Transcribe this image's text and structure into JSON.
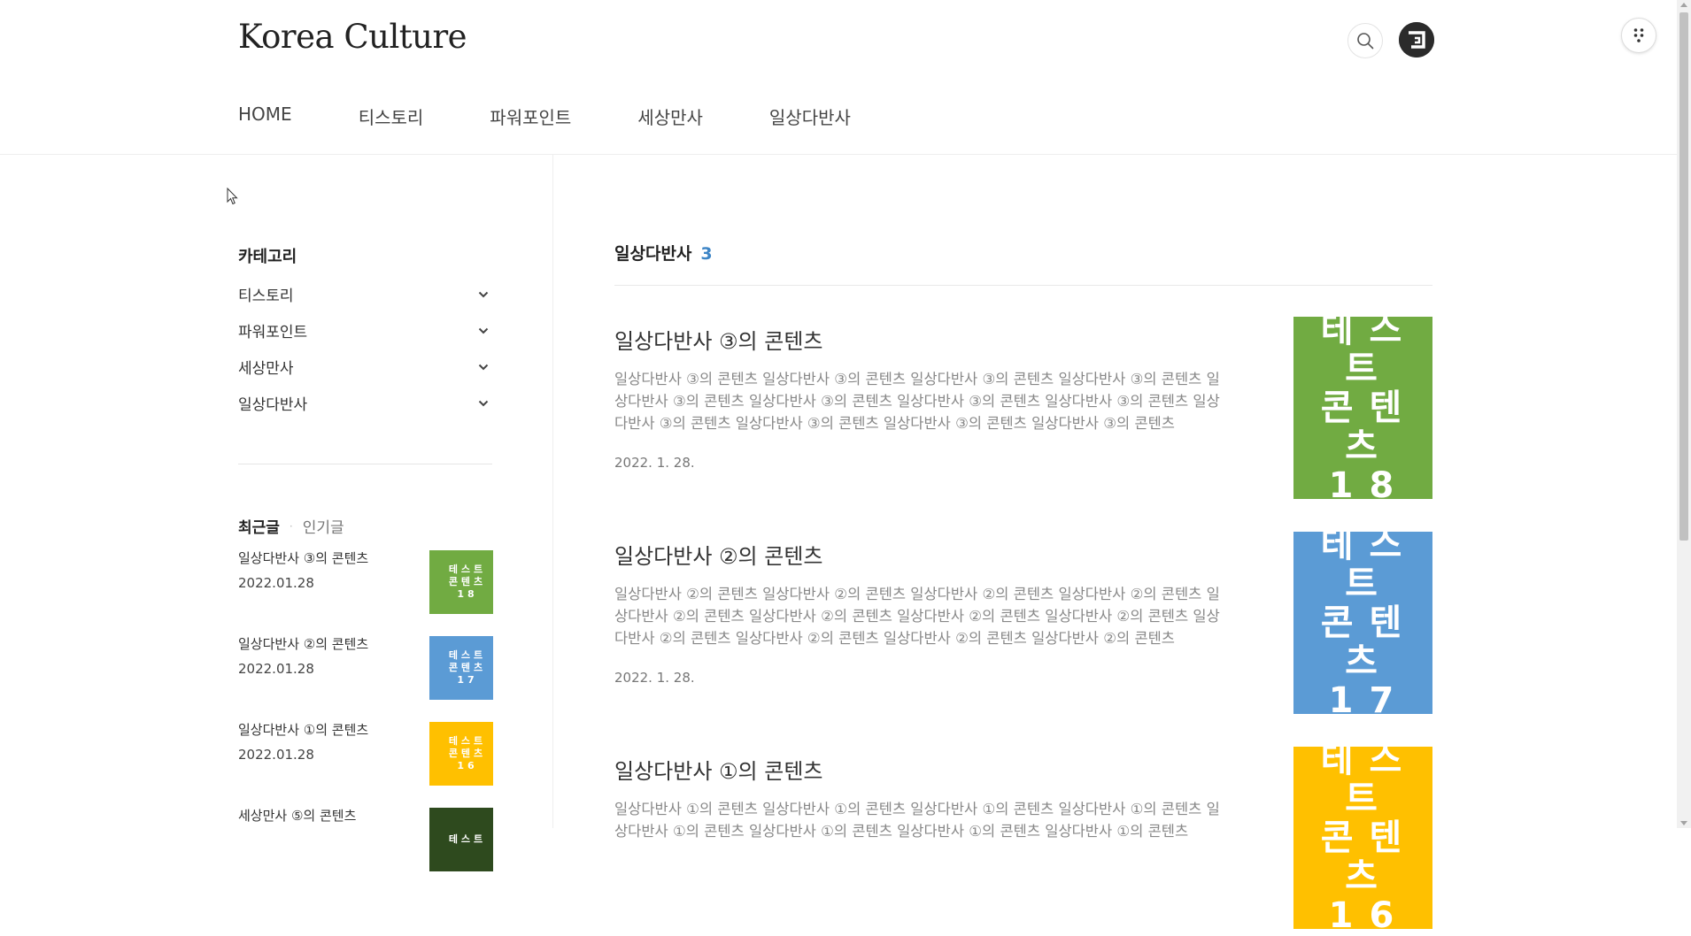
{
  "site": {
    "title": "Korea Culture"
  },
  "nav": {
    "items": [
      "HOME",
      "티스토리",
      "파워포인트",
      "세상만사",
      "일상다반사"
    ]
  },
  "sidebar": {
    "category_title": "카테고리",
    "categories": [
      "티스토리",
      "파워포인트",
      "세상만사",
      "일상다반사"
    ],
    "tabs": {
      "recent": "최근글",
      "popular": "인기글"
    },
    "recent_posts": [
      {
        "title": "일상다반사 ③의 콘텐츠",
        "date": "2022.01.28",
        "thumb_text": "테스트\n콘텐츠\n18",
        "thumb_color": "#71ab42"
      },
      {
        "title": "일상다반사 ②의 콘텐츠",
        "date": "2022.01.28",
        "thumb_text": "테스트\n콘텐츠\n17",
        "thumb_color": "#5b9bd5"
      },
      {
        "title": "일상다반사 ①의 콘텐츠",
        "date": "2022.01.28",
        "thumb_text": "테스트\n콘텐츠\n16",
        "thumb_color": "#ffc000"
      },
      {
        "title": "세상만사 ⑤의 콘텐츠",
        "date": "",
        "thumb_text": "테스트",
        "thumb_color": "#2e4a1e"
      }
    ]
  },
  "main": {
    "category_name": "일상다반사",
    "count": "3",
    "posts": [
      {
        "title": "일상다반사 ③의 콘텐츠",
        "excerpt": "일상다반사 ③의 콘텐츠 일상다반사 ③의 콘텐츠 일상다반사 ③의 콘텐츠 일상다반사 ③의 콘텐츠 일상다반사 ③의 콘텐츠 일상다반사 ③의 콘텐츠 일상다반사 ③의 콘텐츠 일상다반사 ③의 콘텐츠 일상다반사 ③의 콘텐츠 일상다반사 ③의 콘텐츠 일상다반사 ③의 콘텐츠 일상다반사 ③의 콘텐츠",
        "date": "2022. 1. 28.",
        "thumb_text": "테스트\n콘텐츠\n18",
        "thumb_color": "#71ab42"
      },
      {
        "title": "일상다반사 ②의 콘텐츠",
        "excerpt": "일상다반사 ②의 콘텐츠 일상다반사 ②의 콘텐츠 일상다반사 ②의 콘텐츠 일상다반사 ②의 콘텐츠 일상다반사 ②의 콘텐츠 일상다반사 ②의 콘텐츠 일상다반사 ②의 콘텐츠 일상다반사 ②의 콘텐츠 일상다반사 ②의 콘텐츠 일상다반사 ②의 콘텐츠 일상다반사 ②의 콘텐츠 일상다반사 ②의 콘텐츠",
        "date": "2022. 1. 28.",
        "thumb_text": "테스트\n콘텐츠\n17",
        "thumb_color": "#5b9bd5"
      },
      {
        "title": "일상다반사 ①의 콘텐츠",
        "excerpt": "일상다반사 ①의 콘텐츠 일상다반사 ①의 콘텐츠 일상다반사 ①의 콘텐츠 일상다반사 ①의 콘텐츠 일상다반사 ①의 콘텐츠 일상다반사 ①의 콘텐츠 일상다반사 ①의 콘텐츠 일상다반사 ①의 콘텐츠",
        "date": "",
        "thumb_text": "테스트\n콘텐츠\n16",
        "thumb_color": "#ffc000"
      }
    ]
  },
  "icons": {
    "search": "search-icon",
    "avatar": "avatar-icon",
    "menu": "more-menu-icon",
    "chevron": "chevron-down-icon"
  }
}
